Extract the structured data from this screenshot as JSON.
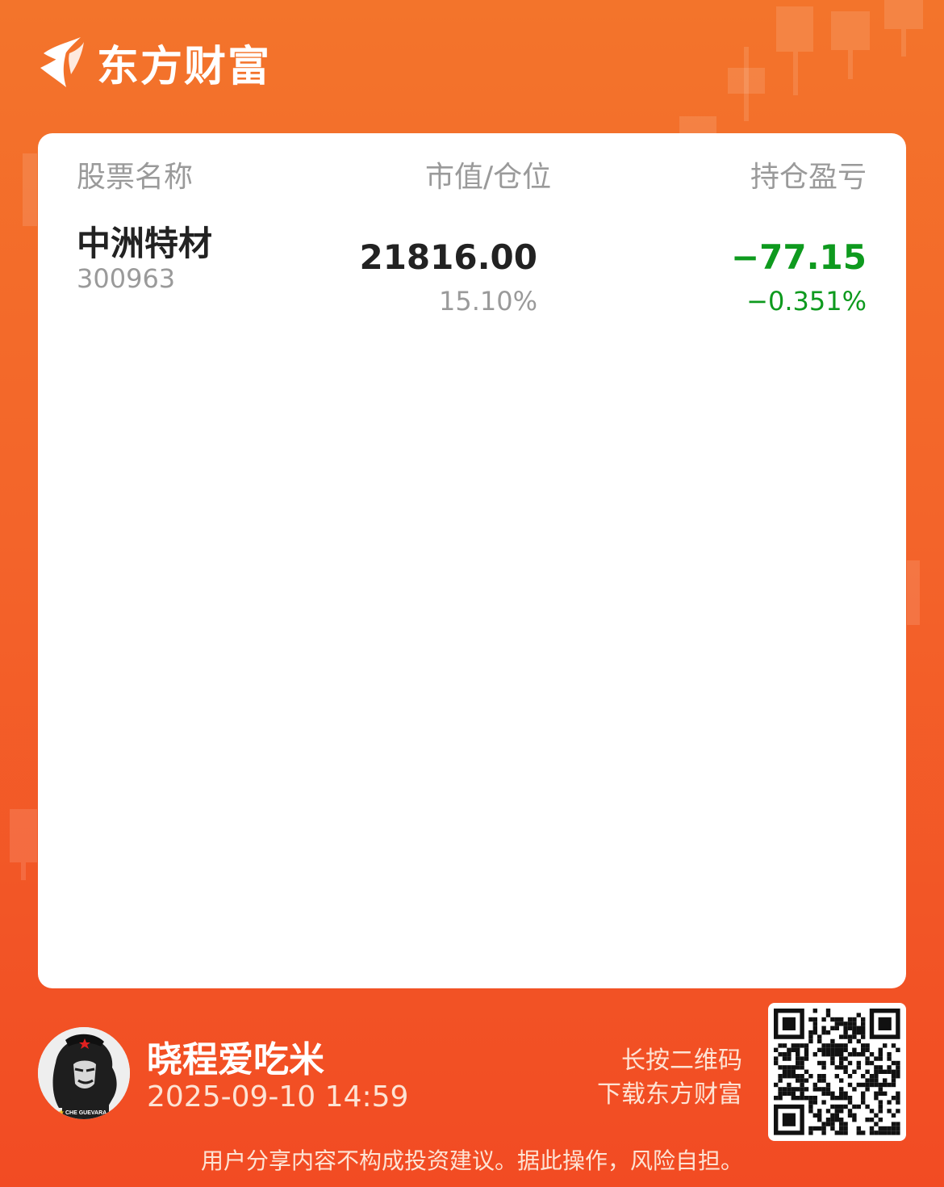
{
  "brand": {
    "name": "东方财富",
    "logo_icon": "eastmoney-logo-icon"
  },
  "table": {
    "headers": {
      "name": "股票名称",
      "market_value": "市值/仓位",
      "profit_loss": "持仓盈亏"
    },
    "rows": [
      {
        "name": "中洲特材",
        "code": "300963",
        "market_value": "21816.00",
        "position": "15.10%",
        "profit_loss": "−77.15",
        "profit_loss_pct": "−0.351%"
      }
    ]
  },
  "footer": {
    "username": "晓程爱吃米",
    "timestamp": "2025-09-10 14:59",
    "qr_hint_line1": "长按二维码",
    "qr_hint_line2": "下载东方财富",
    "disclaimer": "用户分享内容不构成投资建议。据此操作，风险自担。",
    "avatar_badge_text": "CHE GUEVARA"
  },
  "colors": {
    "background_top": "#f3742b",
    "background_bottom": "#f24b23",
    "loss_green": "#0e9a1e",
    "header_gray": "#9a9a9a",
    "text_dark": "#222222"
  }
}
